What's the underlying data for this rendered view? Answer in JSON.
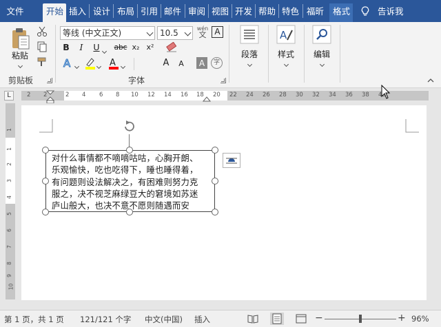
{
  "tabs": [
    {
      "label": "文件"
    },
    {
      "label": "开始"
    },
    {
      "label": "插入"
    },
    {
      "label": "设计"
    },
    {
      "label": "布局"
    },
    {
      "label": "引用"
    },
    {
      "label": "邮件"
    },
    {
      "label": "审阅"
    },
    {
      "label": "视图"
    },
    {
      "label": "开发"
    },
    {
      "label": "帮助"
    },
    {
      "label": "特色"
    },
    {
      "label": "福昕"
    },
    {
      "label": "格式"
    }
  ],
  "tell_me": "告诉我",
  "ribbon": {
    "clipboard": {
      "paste": "粘贴",
      "label": "剪贴板"
    },
    "font": {
      "label": "字体",
      "font_name": "等线 (中文正文)",
      "font_size": "10.5",
      "bold": "B",
      "italic": "I",
      "underline": "U",
      "strike": "abc",
      "subscript": "x₂",
      "superscript": "x²",
      "phonetic_top": "wén",
      "phonetic_bottom": "文",
      "border_char": "A",
      "grow": "A",
      "shrink": "A",
      "shade_char": "A",
      "enclose_char": "字"
    },
    "paragraph": {
      "label": "段落"
    },
    "styles": {
      "label": "样式"
    },
    "editing": {
      "label": "编辑"
    }
  },
  "ruler": {
    "tab_selector": "L",
    "h_numbers": [
      "2",
      "2",
      "2",
      "4",
      "6",
      "8",
      "10",
      "12",
      "14",
      "16",
      "18",
      "20",
      "22",
      "24",
      "26",
      "28",
      "30",
      "32",
      "34",
      "36",
      "38",
      "40"
    ],
    "v_numbers": [
      "1",
      "1",
      "2",
      "3",
      "4",
      "5",
      "6",
      "7",
      "8",
      "9",
      "10"
    ]
  },
  "textbox": {
    "lines": [
      "对什么事情都不嘀嘀咕咕，心胸开朗、",
      "乐观愉快，吃也吃得下，睡也睡得着，",
      "有问题则设法解决之，有困难则努力克",
      "服之，决不视芝麻绿豆大的窘境如苏迷",
      "庐山般大，也决不意不愿则随遇而安"
    ]
  },
  "status": {
    "page": "第 1 页，共 1 页",
    "words": "121/121 个字",
    "language": "中文(中国)",
    "mode": "插入",
    "zoom": "96%"
  },
  "colors": {
    "accent": "#2b579a",
    "highlight": "#ffff00",
    "font_color": "#ff0000"
  }
}
